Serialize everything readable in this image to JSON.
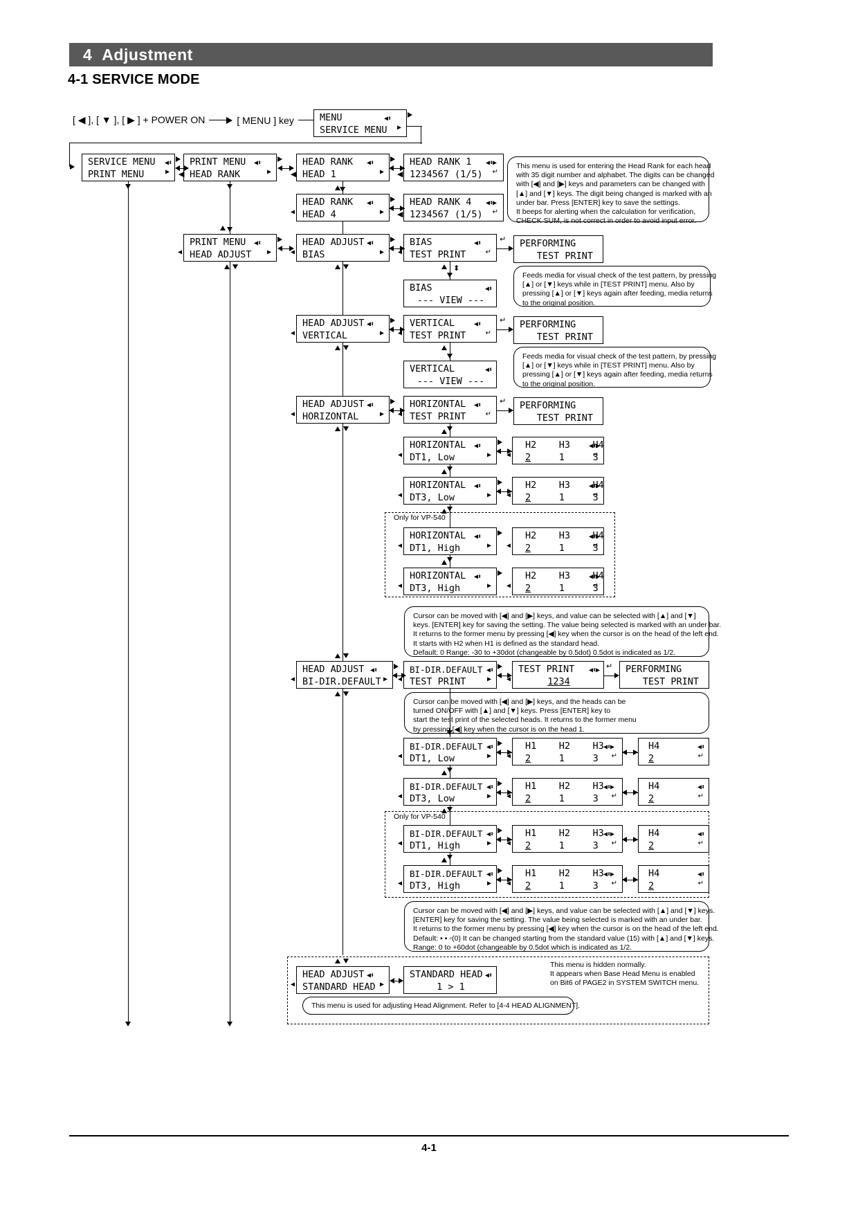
{
  "header": {
    "chapter_number": "4",
    "chapter_title": "Adjustment",
    "section_title": "4-1 SERVICE MODE"
  },
  "key_sequence": {
    "combo": "[ ◀ ], [ ▼ ], [ ▶ ] + POWER ON",
    "then": "[ MENU ] key"
  },
  "lcd": {
    "menu_service": {
      "line1": "MENU",
      "line2": "SERVICE MENU"
    },
    "service_print": {
      "line1": "SERVICE MENU",
      "line2": "PRINT MENU"
    },
    "print_headrank": {
      "line1": "PRINT MENU",
      "line2": "HEAD RANK"
    },
    "headrank_head1": {
      "line1": "HEAD RANK",
      "line2": "HEAD 1"
    },
    "headrank_head4": {
      "line1": "HEAD RANK",
      "line2": "HEAD 4"
    },
    "headrank1_val": {
      "line1": "HEAD RANK 1",
      "line2": "1234567 (1/5)"
    },
    "headrank4_val": {
      "line1": "HEAD RANK 4",
      "line2": "1234567 (1/5)"
    },
    "print_headadjust": {
      "line1": "PRINT MENU",
      "line2": "HEAD ADJUST"
    },
    "adjust_bias": {
      "line1": "HEAD ADJUST",
      "line2": "BIAS"
    },
    "bias_test": {
      "line1": "BIAS",
      "line2": "TEST PRINT"
    },
    "bias_view": {
      "line1": "BIAS",
      "line2": "--- VIEW ---"
    },
    "performing1": {
      "line1": "PERFORMING",
      "line2": "TEST PRINT"
    },
    "adjust_vertical": {
      "line1": "HEAD ADJUST",
      "line2": "VERTICAL"
    },
    "vertical_test": {
      "line1": "VERTICAL",
      "line2": "TEST PRINT"
    },
    "vertical_view": {
      "line1": "VERTICAL",
      "line2": "--- VIEW ---"
    },
    "performing2": {
      "line1": "PERFORMING",
      "line2": "TEST PRINT"
    },
    "adjust_horizontal": {
      "line1": "HEAD ADJUST",
      "line2": "HORIZONTAL"
    },
    "horizontal_test": {
      "line1": "HORIZONTAL",
      "line2": "TEST PRINT"
    },
    "performing3": {
      "line1": "PERFORMING",
      "line2": "TEST PRINT"
    },
    "horizontal_dt1low": {
      "line1": "HORIZONTAL",
      "line2": "DT1, Low"
    },
    "horizontal_dt3low": {
      "line1": "HORIZONTAL",
      "line2": "DT3, Low"
    },
    "horizontal_dt1high": {
      "line1": "HORIZONTAL",
      "line2": "DT1, High"
    },
    "horizontal_dt3high": {
      "line1": "HORIZONTAL",
      "line2": "DT3, High"
    },
    "h234_header": "H2    H3    H4",
    "h234_values": {
      "h2": "2",
      "h3": "1",
      "h4": "3"
    },
    "adjust_bidir": {
      "line1": "HEAD ADJUST",
      "line2": "BI-DIR.DEFAULT"
    },
    "bidir_test": {
      "line1": "BI-DIR.DEFAULT",
      "line2": "TEST PRINT"
    },
    "testprint_1234": {
      "line1": "TEST PRINT",
      "line2": "1234"
    },
    "performing4": {
      "line1": "PERFORMING",
      "line2": "TEST PRINT"
    },
    "bidir_dt1low": {
      "line1": "BI-DIR.DEFAULT",
      "line2": "DT1, Low"
    },
    "bidir_dt3low": {
      "line1": "BI-DIR.DEFAULT",
      "line2": "DT3, Low"
    },
    "bidir_dt1high": {
      "line1": "BI-DIR.DEFAULT",
      "line2": "DT1, High"
    },
    "bidir_dt3high": {
      "line1": "BI-DIR.DEFAULT",
      "line2": "DT3, High"
    },
    "h123_header": "H1    H2    H3",
    "h123_values": {
      "h1": "2",
      "h2": "1",
      "h3": "3"
    },
    "h4_header": "H4",
    "h4_value": "2",
    "adjust_standardhead": {
      "line1": "HEAD ADJUST",
      "line2": "STANDARD HEAD"
    },
    "standardhead_val": {
      "line1": "STANDARD HEAD",
      "line2": "1 > 1"
    }
  },
  "notes": {
    "head_rank": [
      "This menu is used for entering the Head Rank for each head",
      "with 35 digit number and alphabet. The digits can be changed",
      "with [◀] and [▶] keys and parameters can be changed with",
      "[▲] and [▼] keys. The digit being changed is marked with an",
      "under bar. Press [ENTER] key to save the settings.",
      "It beeps for alerting when the calculation for verification,",
      "CHECK SUM, is not correct in order to avoid input error."
    ],
    "feed_bias": [
      "Feeds media for visual check of the test pattern, by pressing",
      "[▲] or [▼]  keys while in [TEST PRINT] menu. Also by",
      "pressing [▲] or [▼] keys again after feeding, media returns",
      "to the original position."
    ],
    "feed_vertical": [
      "Feeds media for visual check of the test pattern, by pressing",
      "[▲] or [▼]  keys while in [TEST PRINT] menu. Also by",
      "pressing [▲] or [▼] keys again after feeding, media returns",
      "to the original position."
    ],
    "horizontal_cursor": [
      "Cursor can be moved with [◀] and [▶] keys, and value can be selected with [▲] and [▼]",
      "keys. [ENTER] key for saving the setting. The value being selected is marked with an under bar.",
      "It returns to the former menu by pressing [◀] key when the cursor is on the head of the left end.",
      "It starts with H2 when H1 is defined as the standard head.",
      "Default: 0    Range: -30 to +30dot (changeable by 0.5dot) 0.5dot is indicated as 1/2."
    ],
    "bidir_testprint": [
      "Cursor can be moved with [◀] and [▶] keys, and the heads can be",
      "turned ON/OFF with [▲] and [▼] keys. Press [ENTER] key to",
      "start the test print of the selected heads. It returns to the former menu",
      "by pressing [◀] key when the cursor is on the head 1."
    ],
    "bidir_cursor": [
      "Cursor can be moved with [◀] and [▶] keys, and value can be selected with [▲] and [▼] keys.",
      "[ENTER] key for saving the setting. The value being selected is marked with an under bar.",
      "It returns to the former menu by pressing [◀] key when the cursor is on the head of the left end.",
      "Default: ▪ ▪ ▫(0)   It can be changed starting from the standard value (15) with [▲] and [▼] keys.",
      "Range: 0 to +60dot (changeable by 0.5dot which is indicated as 1/2."
    ],
    "standard_head": [
      "This menu is hidden normally.",
      "It appears when Base Head Menu is enabled",
      "on Bit6 of PAGE2 in SYSTEM SWITCH menu."
    ],
    "head_alignment": "This menu is used for adjusting Head Alignment. Refer to [4-4 HEAD ALIGNMENT]."
  },
  "dashed_labels": {
    "vp540_horizontal": "Only for VP-540",
    "vp540_bidir": "Only for VP-540"
  },
  "footer": {
    "page_number": "4-1"
  }
}
